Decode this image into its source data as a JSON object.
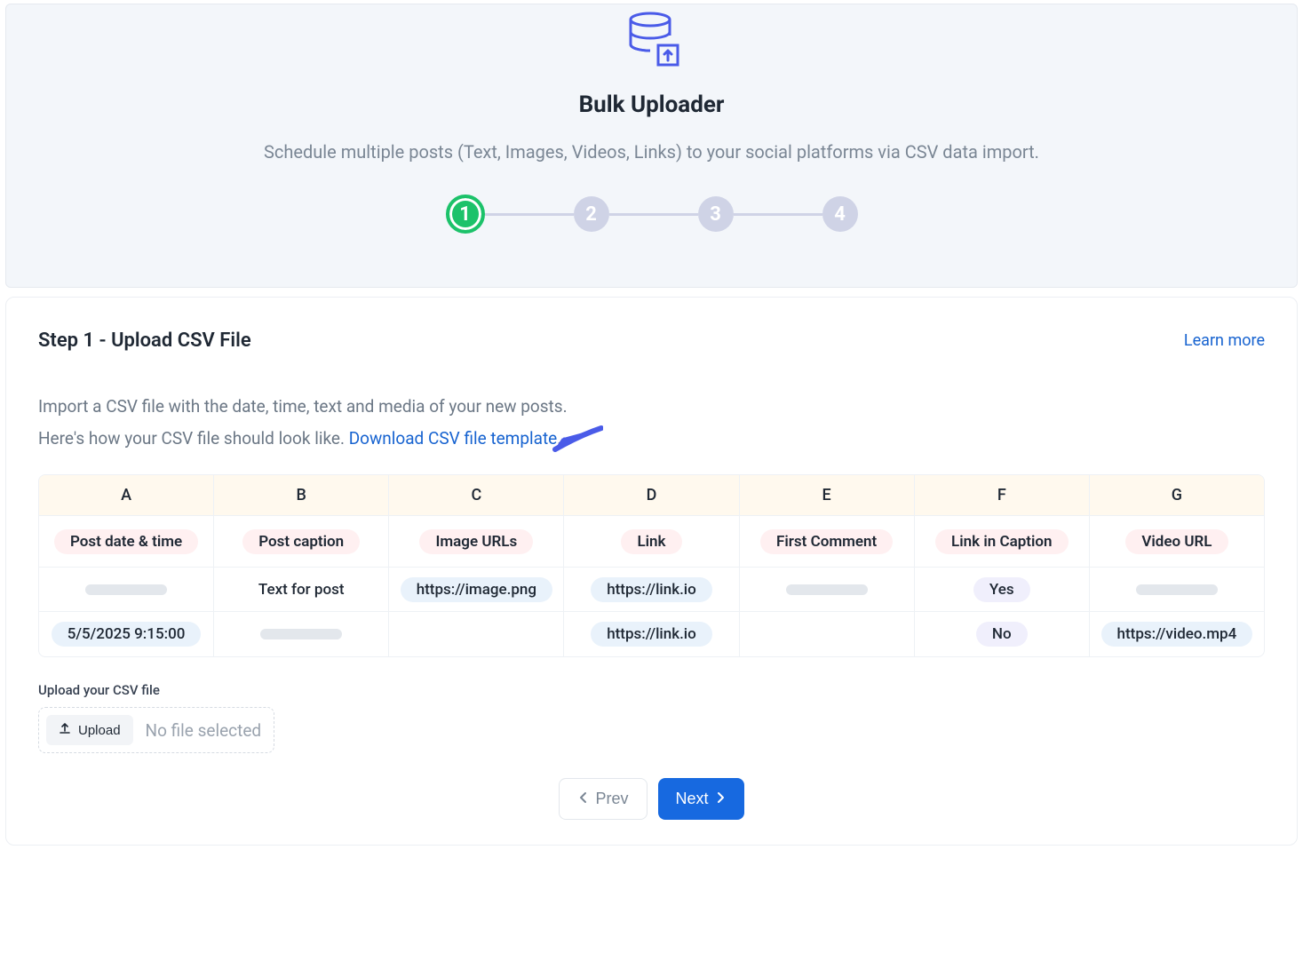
{
  "header": {
    "title": "Bulk Uploader",
    "subtitle": "Schedule multiple posts (Text, Images, Videos, Links) to your social platforms via CSV data import."
  },
  "stepper": {
    "steps": [
      "1",
      "2",
      "3",
      "4"
    ],
    "active_index": 0
  },
  "step": {
    "title": "Step 1 - Upload CSV File",
    "learn_more": "Learn more",
    "desc_line1": "Import a CSV file with the date, time, text and media of your new posts.",
    "desc_line2_prefix": "Here's how your CSV file should look like. ",
    "download_link": "Download CSV file template",
    "period": "."
  },
  "table": {
    "letters": [
      "A",
      "B",
      "C",
      "D",
      "E",
      "F",
      "G"
    ],
    "headers": [
      "Post date & time",
      "Post caption",
      "Image URLs",
      "Link",
      "First Comment",
      "Link in Caption",
      "Video URL"
    ],
    "rows": [
      [
        {
          "kind": "skeleton"
        },
        {
          "kind": "plain",
          "value": "Text for post"
        },
        {
          "kind": "blue",
          "value": "https://image.png"
        },
        {
          "kind": "blue",
          "value": "https://link.io"
        },
        {
          "kind": "skeleton"
        },
        {
          "kind": "purple",
          "value": "Yes"
        },
        {
          "kind": "skeleton"
        }
      ],
      [
        {
          "kind": "blue",
          "value": "5/5/2025 9:15:00"
        },
        {
          "kind": "skeleton"
        },
        {
          "kind": "empty"
        },
        {
          "kind": "blue",
          "value": "https://link.io"
        },
        {
          "kind": "empty"
        },
        {
          "kind": "purple",
          "value": "No"
        },
        {
          "kind": "blue",
          "value": "https://video.mp4"
        }
      ]
    ]
  },
  "upload": {
    "label": "Upload your CSV file",
    "button": "Upload",
    "no_file": "No file selected"
  },
  "nav": {
    "prev": "Prev",
    "next": "Next"
  }
}
